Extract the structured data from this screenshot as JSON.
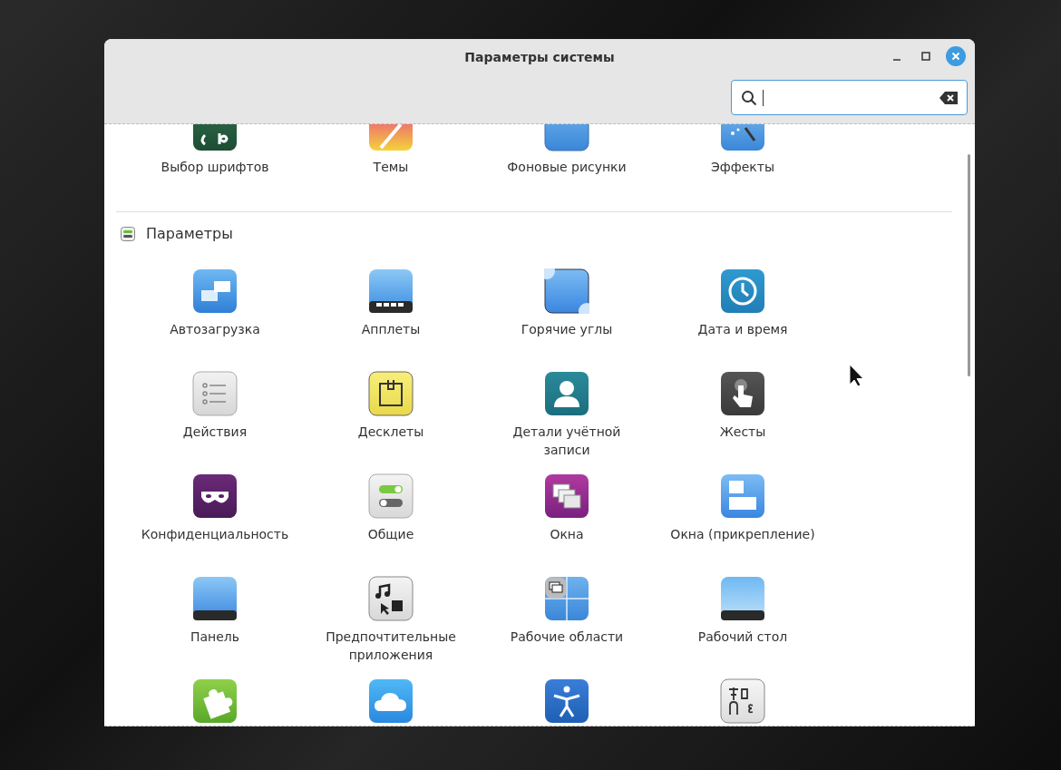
{
  "window": {
    "title": "Параметры системы"
  },
  "search": {
    "focused": true
  },
  "sections": [
    {
      "items": [
        {
          "kind": "fonts",
          "label": "Выбор шрифтов"
        },
        {
          "kind": "themes",
          "label": "Темы"
        },
        {
          "kind": "backgrounds",
          "label": "Фоновые рисунки"
        },
        {
          "kind": "effects",
          "label": "Эффекты"
        }
      ]
    },
    {
      "title": "Параметры",
      "items": [
        {
          "kind": "startup",
          "label": "Автозагрузка"
        },
        {
          "kind": "applets",
          "label": "Апплеты"
        },
        {
          "kind": "hotcorners",
          "label": "Горячие углы"
        },
        {
          "kind": "datetime",
          "label": "Дата и время"
        },
        {
          "kind": "actions",
          "label": "Действия"
        },
        {
          "kind": "desklets",
          "label": "Десклеты"
        },
        {
          "kind": "account",
          "label": "Детали учётной записи"
        },
        {
          "kind": "gestures",
          "label": "Жесты"
        },
        {
          "kind": "privacy",
          "label": "Конфиденциальность"
        },
        {
          "kind": "general",
          "label": "Общие"
        },
        {
          "kind": "windows",
          "label": "Окна"
        },
        {
          "kind": "tiling",
          "label": "Окна (прикрепление)"
        },
        {
          "kind": "panel",
          "label": "Панель"
        },
        {
          "kind": "apps",
          "label": "Предпочтительные приложения"
        },
        {
          "kind": "workspaces",
          "label": "Рабочие области"
        },
        {
          "kind": "desktop",
          "label": "Рабочий стол"
        },
        {
          "kind": "extensions"
        },
        {
          "kind": "online"
        },
        {
          "kind": "accessibility"
        },
        {
          "kind": "languages"
        }
      ]
    }
  ]
}
